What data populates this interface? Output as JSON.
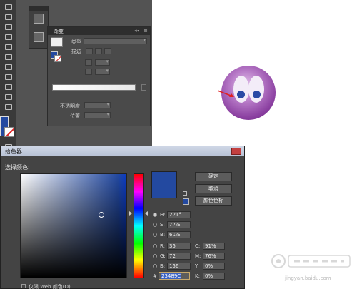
{
  "tools_panel": {
    "fill_color": "#2349a0"
  },
  "gradient_panel": {
    "title": "渐变",
    "type_label": "类型",
    "stroke_label": "描边",
    "opacity_label": "不透明度",
    "location_label": "位置"
  },
  "illustration": {
    "sphere_colors": [
      "#e6c7ee",
      "#8a3fa0",
      "#2a4aa5"
    ],
    "arrow_color": "#e02020"
  },
  "color_picker": {
    "title": "拾色器",
    "select_color_label": "选择颜色:",
    "buttons": {
      "ok": "确定",
      "cancel": "取消",
      "swatches": "颜色色标"
    },
    "fields": {
      "h": {
        "label": "H:",
        "value": "221°"
      },
      "s": {
        "label": "S:",
        "value": "77%"
      },
      "b": {
        "label": "B:",
        "value": "61%"
      },
      "r": {
        "label": "R:",
        "value": "35"
      },
      "g": {
        "label": "G:",
        "value": "72"
      },
      "b2": {
        "label": "B:",
        "value": "156"
      },
      "c": {
        "label": "C:",
        "value": "91%"
      },
      "m": {
        "label": "M:",
        "value": "76%"
      },
      "y": {
        "label": "Y:",
        "value": "0%"
      },
      "k": {
        "label": "K:",
        "value": "0%"
      }
    },
    "hex": {
      "label": "#",
      "value": "23489C"
    },
    "web_only_label": "仅限 Web 颜色(O)",
    "current_color": "#2349a0"
  },
  "watermark": {
    "text": "jingyan.baidu.com"
  }
}
